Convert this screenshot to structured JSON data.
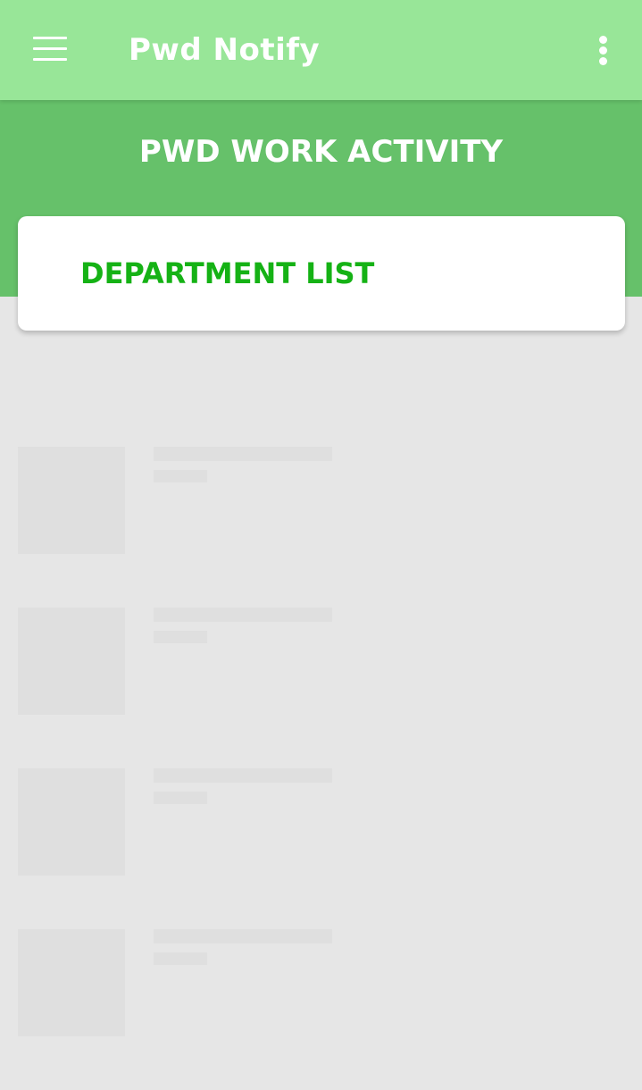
{
  "app_bar": {
    "title": "Pwd Notify",
    "menu_icon": "hamburger-menu-icon",
    "overflow_icon": "more-vertical-icon",
    "background_color": "#98e698"
  },
  "header": {
    "title": "PWD WORK ACTIVITY",
    "background_color": "#66c16a"
  },
  "department_card": {
    "label": "DEPARTMENT LIST",
    "label_color": "#15b215"
  },
  "loading_placeholders": {
    "count": 4,
    "color": "#dfdfdf"
  },
  "page_background": "#e6e6e6"
}
